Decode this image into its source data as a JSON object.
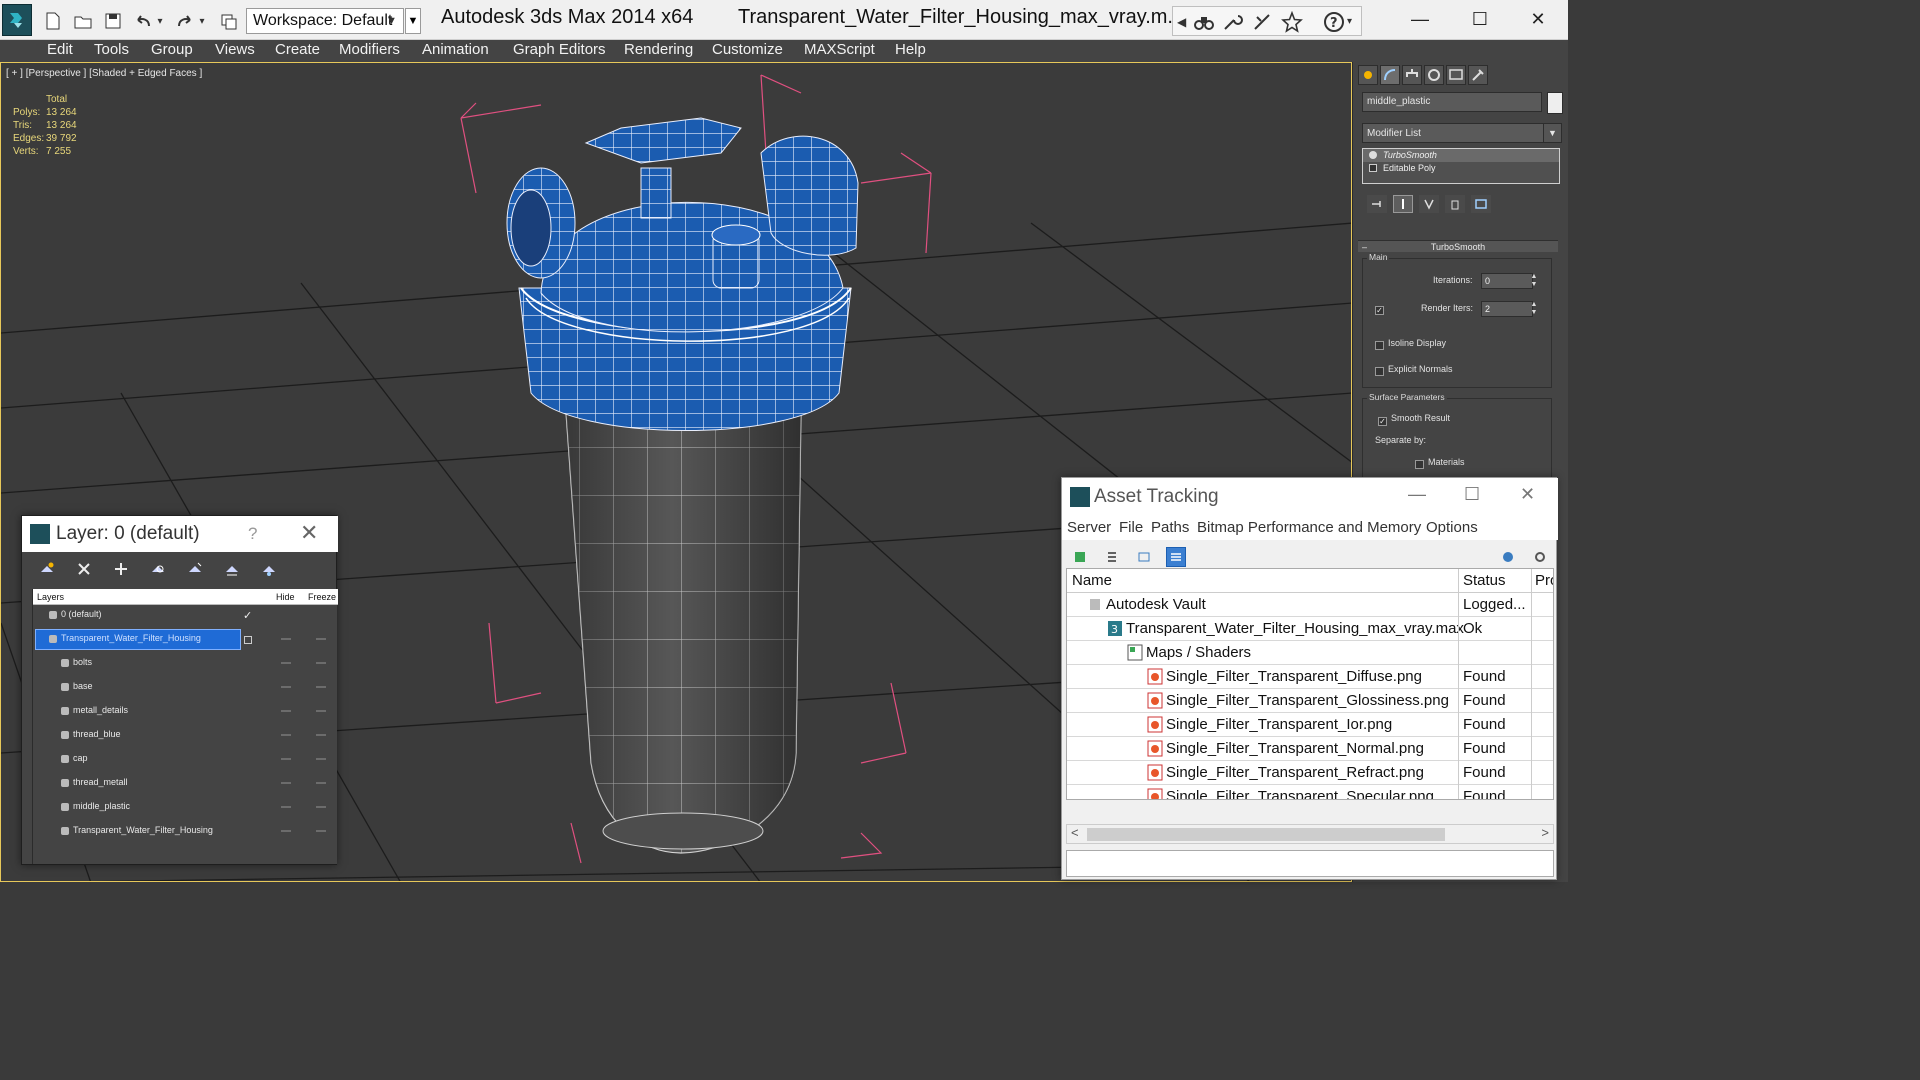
{
  "app": {
    "title": "Autodesk 3ds Max  2014 x64",
    "file_title": "Transparent_Water_Filter_Housing_max_vray.m...",
    "workspace_label": "Workspace: Default"
  },
  "menu": [
    "Edit",
    "Tools",
    "Group",
    "Views",
    "Create",
    "Modifiers",
    "Animation",
    "Graph Editors",
    "Rendering",
    "Customize",
    "MAXScript",
    "Help"
  ],
  "viewport": {
    "label": "[ + ] [Perspective ] [Shaded + Edged Faces ]",
    "stats": {
      "header": "Total",
      "rows": [
        {
          "key": "Polys:",
          "value": "13 264"
        },
        {
          "key": "Tris:",
          "value": "13 264"
        },
        {
          "key": "Edges:",
          "value": "39 792"
        },
        {
          "key": "Verts:",
          "value": "7 255"
        }
      ]
    }
  },
  "command_panel": {
    "object_name": "middle_plastic",
    "modifier_list": "Modifier List",
    "stack": [
      "TurboSmooth",
      "Editable Poly"
    ],
    "rollout_title": "TurboSmooth",
    "main_group": "Main",
    "iterations_label": "Iterations:",
    "iterations_value": "0",
    "render_iters_label": "Render Iters:",
    "render_iters_value": "2",
    "isoline_label": "Isoline Display",
    "explicit_normals_label": "Explicit Normals",
    "surface_group": "Surface Parameters",
    "smooth_result_label": "Smooth Result",
    "separate_by_label": "Separate by:",
    "materials_label": "Materials"
  },
  "layer_dialog": {
    "title": "Layer: 0 (default)",
    "help": "?",
    "columns": {
      "layers": "Layers",
      "hide": "Hide",
      "freeze": "Freeze"
    },
    "rows": [
      {
        "name": "0 (default)",
        "level": 0
      },
      {
        "name": "Transparent_Water_Filter_Housing",
        "level": 0
      },
      {
        "name": "bolts",
        "level": 1
      },
      {
        "name": "base",
        "level": 1
      },
      {
        "name": "metall_details",
        "level": 1
      },
      {
        "name": "thread_blue",
        "level": 1
      },
      {
        "name": "cap",
        "level": 1
      },
      {
        "name": "thread_metall",
        "level": 1
      },
      {
        "name": "middle_plastic",
        "level": 1
      },
      {
        "name": "Transparent_Water_Filter_Housing",
        "level": 1
      }
    ]
  },
  "asset_dialog": {
    "title": "Asset Tracking",
    "menu": [
      "Server",
      "File",
      "Paths",
      "Bitmap Performance and Memory",
      "Options"
    ],
    "columns": {
      "name": "Name",
      "status": "Status",
      "pro": "Pro"
    },
    "rows": [
      {
        "name": "Autodesk Vault",
        "status": "Logged...",
        "level": 0
      },
      {
        "name": "Transparent_Water_Filter_Housing_max_vray.max",
        "status": "Ok",
        "level": 1
      },
      {
        "name": "Maps / Shaders",
        "status": "",
        "level": 2
      },
      {
        "name": "Single_Filter_Transparent_Diffuse.png",
        "status": "Found",
        "level": 3
      },
      {
        "name": "Single_Filter_Transparent_Glossiness.png",
        "status": "Found",
        "level": 3
      },
      {
        "name": "Single_Filter_Transparent_Ior.png",
        "status": "Found",
        "level": 3
      },
      {
        "name": "Single_Filter_Transparent_Normal.png",
        "status": "Found",
        "level": 3
      },
      {
        "name": "Single_Filter_Transparent_Refract.png",
        "status": "Found",
        "level": 3
      },
      {
        "name": "Single_Filter_Transparent_Specular.png",
        "status": "Found",
        "level": 3
      }
    ]
  },
  "colors": {
    "accent_blue": "#1f6bd6",
    "model_blue": "#1a5fb4",
    "viewport_bg": "#3b3b3b",
    "stats_yellow": "#e8d77a"
  }
}
